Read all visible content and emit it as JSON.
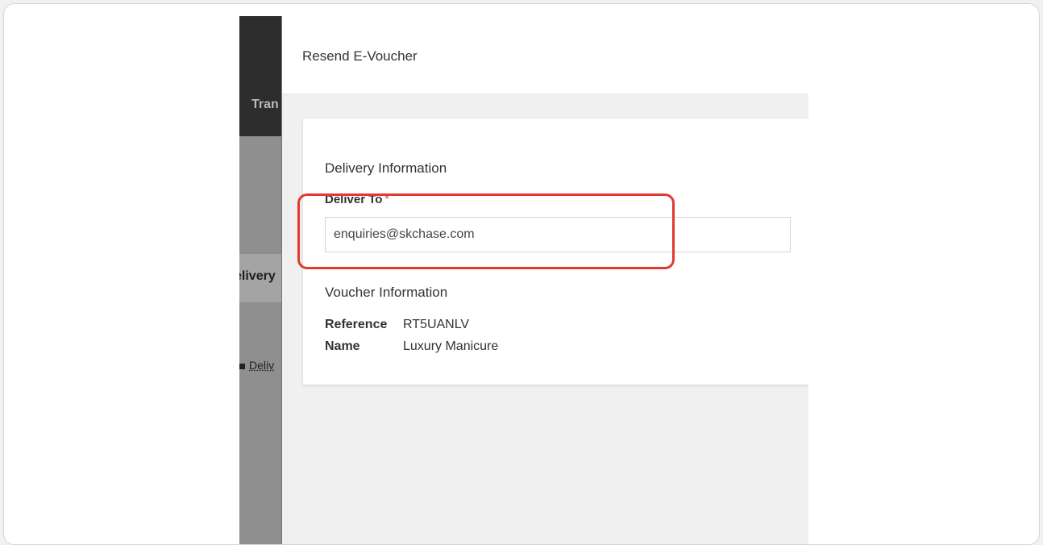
{
  "background_app": {
    "topbar_text": "Tran",
    "row_text": "elivery",
    "link_text": "Deliv"
  },
  "modal": {
    "title": "Resend E-Voucher",
    "delivery_section": {
      "title": "Delivery Information",
      "deliver_to_label": "Deliver To",
      "required_marker": "*",
      "deliver_to_value": "enquiries@skchase.com"
    },
    "voucher_section": {
      "title": "Voucher Information",
      "rows": [
        {
          "key": "Reference",
          "value": "RT5UANLV"
        },
        {
          "key": "Name",
          "value": "Luxury Manicure"
        }
      ]
    }
  },
  "colors": {
    "highlight": "#e03a2e",
    "required": "#d63a3a"
  }
}
